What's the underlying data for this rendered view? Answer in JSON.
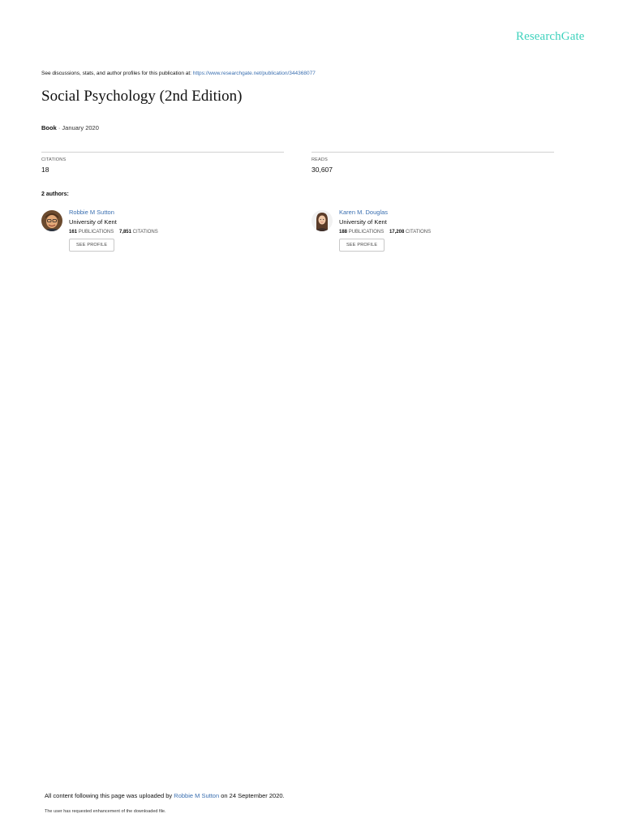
{
  "header": {
    "logo_text": "ResearchGate",
    "discussion_prefix": "See discussions, stats, and author profiles for this publication at: ",
    "publication_url": "https://www.researchgate.net/publication/344368077"
  },
  "publication": {
    "title": "Social Psychology (2nd Edition)",
    "type": "Book",
    "separator": " · ",
    "date": "January 2020"
  },
  "stats": {
    "citations_label": "CITATIONS",
    "citations_value": "18",
    "reads_label": "READS",
    "reads_value": "30,607"
  },
  "authors_heading": "2 authors:",
  "authors": [
    {
      "name": "Robbie M Sutton",
      "affiliation": "University of Kent",
      "publications": "161",
      "publications_label": "PUBLICATIONS",
      "citations": "7,851",
      "citations_label": "CITATIONS",
      "button_label": "SEE PROFILE"
    },
    {
      "name": "Karen M. Douglas",
      "affiliation": "University of Kent",
      "publications": "188",
      "publications_label": "PUBLICATIONS",
      "citations": "17,208",
      "citations_label": "CITATIONS",
      "button_label": "SEE PROFILE"
    }
  ],
  "footer": {
    "upload_prefix": "All content following this page was uploaded by ",
    "uploader": "Robbie M Sutton",
    "upload_suffix": " on 24 September 2020.",
    "enhancement_note": "The user has requested enhancement of the downloaded file."
  },
  "colors": {
    "brand": "#3ed2bd",
    "link": "#3a6fb0"
  }
}
